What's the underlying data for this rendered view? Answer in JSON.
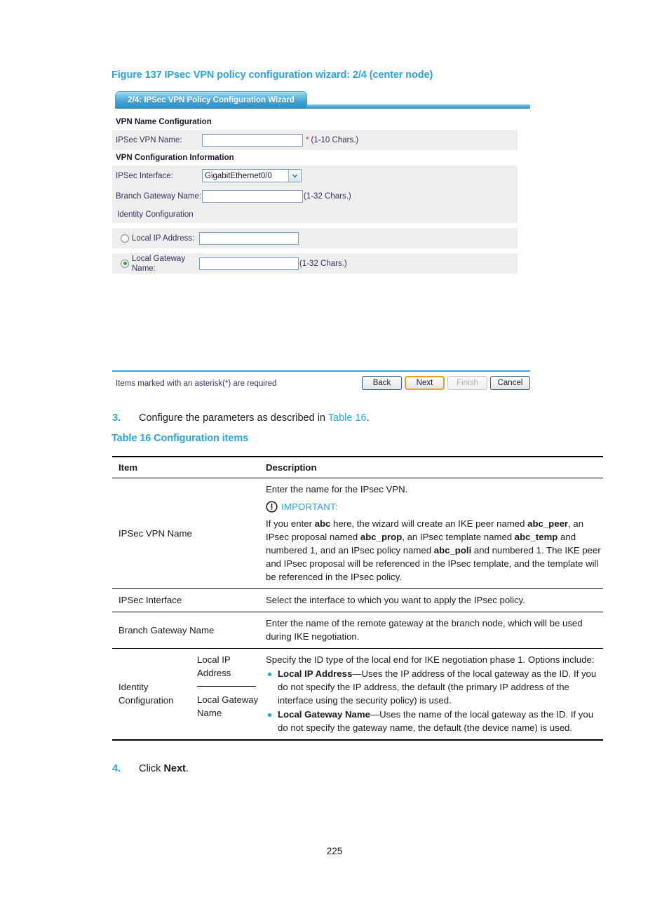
{
  "figure": {
    "caption": "Figure 137 IPsec VPN policy configuration wizard: 2/4 (center node)",
    "tab_label": "2/4: IPSec VPN Policy Configuration Wizard",
    "sections": {
      "vpn_name_configuration": "VPN Name Configuration",
      "vpn_configuration_information": "VPN Configuration Information",
      "identity_configuration": "Identity Configuration"
    },
    "fields": {
      "ipsec_vpn_name": {
        "label": "IPSec VPN Name:",
        "value": "",
        "required_mark": "*",
        "hint": "(1-10 Chars.)"
      },
      "ipsec_interface": {
        "label": "IPSec Interface:",
        "value": "GigabitEthernet0/0"
      },
      "branch_gateway_name": {
        "label": "Branch Gateway Name:",
        "value": "",
        "hint": "(1-32 Chars.)"
      },
      "local_ip_address": {
        "label": "Local IP Address:",
        "value": "",
        "selected": false
      },
      "local_gateway_name": {
        "label": "Local Gateway Name:",
        "value": "",
        "hint": "(1-32 Chars.)",
        "selected": true
      }
    },
    "footer": {
      "required_note": "Items marked with an asterisk(*) are required",
      "buttons": {
        "back": "Back",
        "next": "Next",
        "finish": "Finish",
        "cancel": "Cancel"
      }
    },
    "colors": {
      "tab_blue": "#3f9fd1",
      "rule_blue": "#3fa4db",
      "row_gray": "#eeeeee",
      "focus_orange": "#e9a021",
      "radio_green": "#2aa13a",
      "asterisk_red": "#d03030"
    }
  },
  "steps": {
    "three": {
      "number": "3.",
      "text_before": "Configure the parameters as described in ",
      "link": "Table 16",
      "text_after": "."
    },
    "four": {
      "number": "4.",
      "text_before": "Click ",
      "bold": "Next",
      "text_after": "."
    }
  },
  "table": {
    "caption": "Table 16 Configuration items",
    "headers": {
      "item": "Item",
      "description": "Description"
    },
    "rows": [
      {
        "item": "IPSec VPN Name",
        "desc_intro": "Enter the name for the IPsec VPN.",
        "important_label": "IMPORTANT:",
        "important_body": [
          {
            "t": "If you enter "
          },
          {
            "t": "abc",
            "b": true
          },
          {
            "t": " here, the wizard will create an IKE peer named "
          },
          {
            "t": "abc_peer",
            "b": true
          },
          {
            "t": ", an IPsec proposal named "
          },
          {
            "t": "abc_prop",
            "b": true
          },
          {
            "t": ", an IPsec template named "
          },
          {
            "t": "abc_temp",
            "b": true
          },
          {
            "t": " and numbered 1, and an IPsec policy named "
          },
          {
            "t": "abc_poli",
            "b": true
          },
          {
            "t": " and numbered 1. The IKE peer and IPsec proposal will be referenced in the IPsec template, and the template will be referenced in the IPsec policy."
          }
        ]
      },
      {
        "item": "IPSec Interface",
        "desc": "Select the interface to which you want to apply the IPsec policy."
      },
      {
        "item": "Branch Gateway Name",
        "desc": "Enter the name of the remote gateway at the branch node, which will be used during IKE negotiation."
      },
      {
        "item": "Identity Configuration",
        "sub_a": "Local IP Address",
        "sub_b": "Local Gateway Name",
        "desc_intro": "Specify the ID type of the local end for IKE negotiation phase 1. Options include:",
        "bullets": [
          [
            {
              "t": "Local IP Address",
              "b": true
            },
            {
              "t": "—Uses the IP address of the local gateway as the ID. If you do not specify the IP address, the default (the primary IP address of the interface using the security policy) is used."
            }
          ],
          [
            {
              "t": "Local Gateway Name",
              "b": true
            },
            {
              "t": "—Uses the name of the local gateway as the ID. If you do not specify the gateway name, the default (the device name) is used."
            }
          ]
        ]
      }
    ]
  },
  "page_number": "225"
}
